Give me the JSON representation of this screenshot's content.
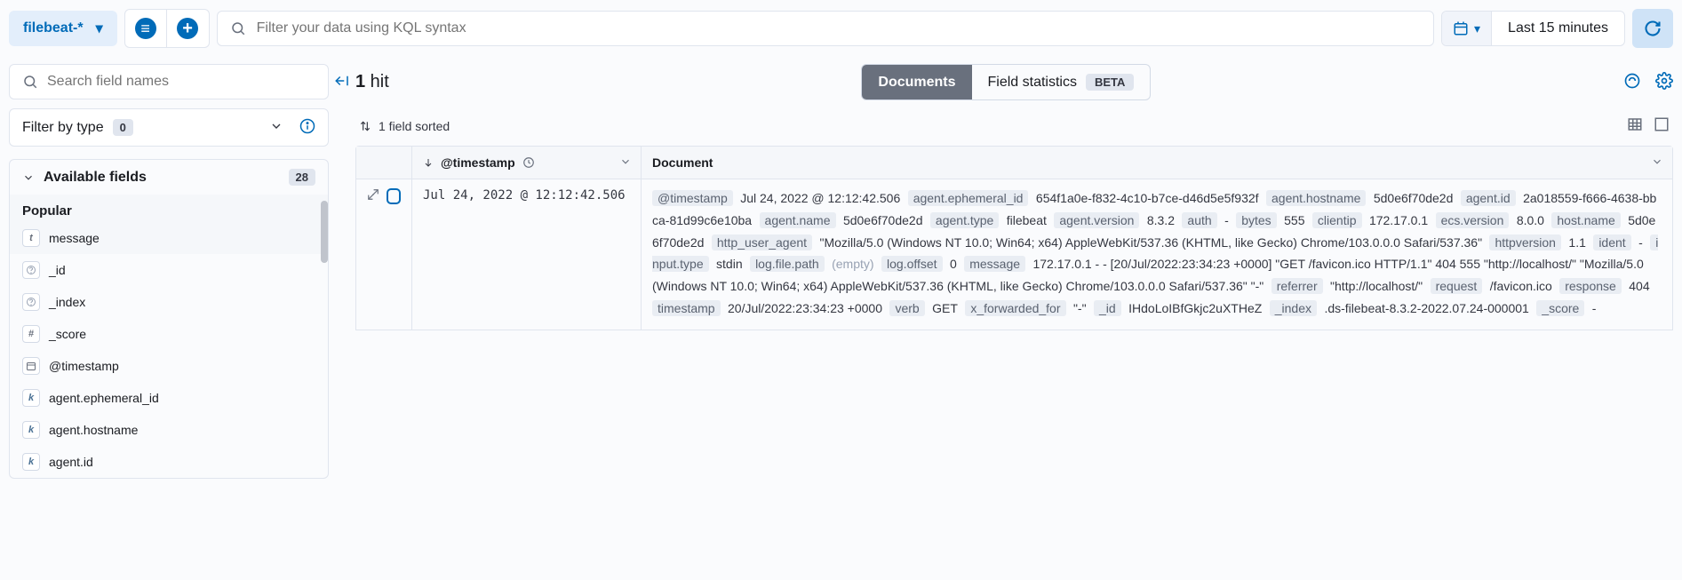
{
  "topbar": {
    "index_pattern": "filebeat-*",
    "search_placeholder": "Filter your data using KQL syntax",
    "time_range": "Last 15 minutes"
  },
  "sidebar": {
    "field_search_placeholder": "Search field names",
    "filter_by_type_label": "Filter by type",
    "filter_by_type_count": "0",
    "available_fields_label": "Available fields",
    "available_fields_count": "28",
    "popular_label": "Popular",
    "popular_fields": [
      {
        "icon": "t",
        "name": "message",
        "icon_class": "txt"
      }
    ],
    "fields": [
      {
        "icon": "?",
        "name": "_id",
        "icon_class": "unknown"
      },
      {
        "icon": "?",
        "name": "_index",
        "icon_class": "unknown"
      },
      {
        "icon": "#",
        "name": "_score",
        "icon_class": "num"
      },
      {
        "icon": "📅",
        "name": "@timestamp",
        "icon_class": "date"
      },
      {
        "icon": "k",
        "name": "agent.ephemeral_id",
        "icon_class": "kw"
      },
      {
        "icon": "k",
        "name": "agent.hostname",
        "icon_class": "kw"
      },
      {
        "icon": "k",
        "name": "agent.id",
        "icon_class": "kw"
      }
    ]
  },
  "content": {
    "hit_count": "1",
    "hit_label": " hit",
    "tabs": {
      "documents": "Documents",
      "field_stats": "Field statistics",
      "beta": "BETA"
    },
    "sort_label": "1 field sorted",
    "columns": {
      "timestamp": "@timestamp",
      "document": "Document"
    },
    "row": {
      "timestamp": "Jul 24, 2022 @ 12:12:42.506",
      "fields": [
        {
          "k": "@timestamp",
          "v": "Jul 24, 2022 @ 12:12:42.506"
        },
        {
          "k": "agent.ephemeral_id",
          "v": "654f1a0e-f832-4c10-b7ce-d46d5e5f932f"
        },
        {
          "k": "agent.hostname",
          "v": "5d0e6f70de2d"
        },
        {
          "k": "agent.id",
          "v": "2a018559-f666-4638-bbca-81d99c6e10ba"
        },
        {
          "k": "agent.name",
          "v": "5d0e6f70de2d"
        },
        {
          "k": "agent.type",
          "v": "filebeat"
        },
        {
          "k": "agent.version",
          "v": "8.3.2"
        },
        {
          "k": "auth",
          "v": "-"
        },
        {
          "k": "bytes",
          "v": "555"
        },
        {
          "k": "clientip",
          "v": "172.17.0.1"
        },
        {
          "k": "ecs.version",
          "v": "8.0.0"
        },
        {
          "k": "host.name",
          "v": "5d0e6f70de2d"
        },
        {
          "k": "http_user_agent",
          "v": "\"Mozilla/5.0 (Windows NT 10.0; Win64; x64) AppleWebKit/537.36 (KHTML, like Gecko) Chrome/103.0.0.0 Safari/537.36\""
        },
        {
          "k": "httpversion",
          "v": "1.1"
        },
        {
          "k": "ident",
          "v": "-"
        },
        {
          "k": "input.type",
          "v": "stdin"
        },
        {
          "k": "log.file.path",
          "v": "(empty)",
          "empty": true
        },
        {
          "k": "log.offset",
          "v": "0"
        },
        {
          "k": "message",
          "v": "172.17.0.1 - - [20/Jul/2022:23:34:23 +0000] \"GET /favicon.ico HTTP/1.1\" 404 555 \"http://localhost/\" \"Mozilla/5.0 (Windows NT 10.0; Win64; x64) AppleWebKit/537.36 (KHTML, like Gecko) Chrome/103.0.0.0 Safari/537.36\" \"-\""
        },
        {
          "k": "referrer",
          "v": "\"http://localhost/\""
        },
        {
          "k": "request",
          "v": "/favicon.ico"
        },
        {
          "k": "response",
          "v": "404"
        },
        {
          "k": "timestamp",
          "v": "20/Jul/2022:23:34:23 +0000"
        },
        {
          "k": "verb",
          "v": "GET"
        },
        {
          "k": "x_forwarded_for",
          "v": "\"-\""
        },
        {
          "k": "_id",
          "v": "IHdoLoIBfGkjc2uXTHeZ"
        },
        {
          "k": "_index",
          "v": ".ds-filebeat-8.3.2-2022.07.24-000001"
        },
        {
          "k": "_score",
          "v": " - "
        }
      ]
    }
  }
}
